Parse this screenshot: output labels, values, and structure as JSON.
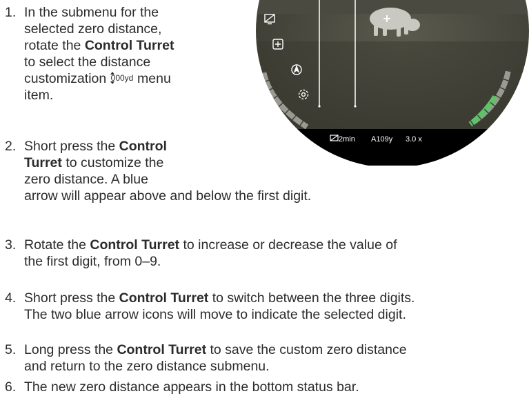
{
  "steps": [
    {
      "num": "1.",
      "lines": [
        [
          {
            "t": "In the submenu for the"
          }
        ],
        [
          {
            "t": "selected zero distance,"
          }
        ],
        [
          {
            "t": "rotate the "
          },
          {
            "t": "Control Turret",
            "b": true
          }
        ],
        [
          {
            "t": "to select the distance"
          }
        ],
        [
          {
            "t": "customization "
          },
          {
            "icon": "zero-distance-icon"
          },
          {
            "t": " menu"
          }
        ],
        [
          {
            "t": "item."
          }
        ]
      ]
    },
    {
      "num": "2.",
      "lines": [
        [
          {
            "t": "Short press the "
          },
          {
            "t": "Control",
            "b": true
          }
        ],
        [
          {
            "t": "Turret",
            "b": true
          },
          {
            "t": " to customize the"
          }
        ],
        [
          {
            "t": "zero distance. A blue"
          }
        ],
        [
          {
            "t": "arrow will appear above and below the first digit."
          }
        ]
      ]
    },
    {
      "num": "3.",
      "lines": [
        [
          {
            "t": "Rotate the "
          },
          {
            "t": "Control Turret",
            "b": true
          },
          {
            "t": " to increase or decrease the value of"
          }
        ],
        [
          {
            "t": "the first digit, from 0–9."
          }
        ]
      ]
    },
    {
      "num": "4.",
      "lines": [
        [
          {
            "t": "Short press the "
          },
          {
            "t": "Control Turret",
            "b": true
          },
          {
            "t": " to switch between the three digits."
          }
        ],
        [
          {
            "t": "The two blue arrow icons will move to indicate the selected digit."
          }
        ]
      ]
    },
    {
      "num": "5.",
      "lines": [
        [
          {
            "t": "Long press the "
          },
          {
            "t": "Control Turret",
            "b": true
          },
          {
            "t": " to save the custom zero distance"
          }
        ],
        [
          {
            "t": "and return to the zero distance submenu."
          }
        ]
      ]
    },
    {
      "num": "6.",
      "lines": [
        [
          {
            "t": "The new zero distance appears in the bottom status bar."
          }
        ]
      ]
    }
  ],
  "inline_icon": {
    "name": "zero-distance-icon",
    "label": "000yd"
  },
  "scope": {
    "status_timer": "2min",
    "status_zero": "A109y",
    "status_zoom": "3.0 x",
    "menu_icons": [
      "display-off-icon",
      "zoom-in-icon",
      "compass-icon",
      "settings-icon"
    ]
  }
}
